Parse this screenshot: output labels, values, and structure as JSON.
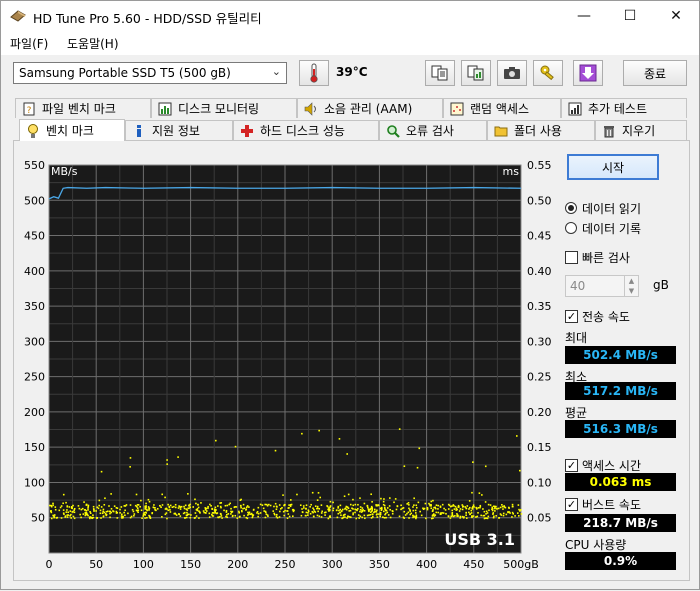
{
  "window": {
    "title": "HD Tune Pro 5.60 - HDD/SSD  유틸리티",
    "minimize": "—",
    "maximize": "☐",
    "close": "✕"
  },
  "menu": {
    "file_label": "파일(F)",
    "help_label": "도움말(H)"
  },
  "toolbar": {
    "drive": "Samsung Portable SSD T5 (500 gB)",
    "temperature": "39°C",
    "exit_label": "종료",
    "icons": [
      "thermometer-icon",
      "copy-text-icon",
      "copy-image-icon",
      "camera-icon",
      "keys-icon",
      "download-icon"
    ]
  },
  "tabs_top": [
    {
      "label": "파일 벤치 마크",
      "icon": "file-benchmark-icon"
    },
    {
      "label": "디스크 모니터링",
      "icon": "disk-monitor-icon"
    },
    {
      "label": "소음 관리 (AAM)",
      "icon": "speaker-icon"
    },
    {
      "label": "랜덤 액세스",
      "icon": "random-access-icon"
    },
    {
      "label": "추가 테스트",
      "icon": "extra-tests-icon"
    }
  ],
  "tabs_bottom": [
    {
      "label": "벤치 마크",
      "icon": "benchmark-icon"
    },
    {
      "label": "지원 정보",
      "icon": "info-icon"
    },
    {
      "label": "하드 디스크 성능",
      "icon": "health-icon"
    },
    {
      "label": "오류 검사",
      "icon": "error-scan-icon"
    },
    {
      "label": "폴더 사용",
      "icon": "folder-icon"
    },
    {
      "label": "지우기",
      "icon": "erase-icon"
    }
  ],
  "controls": {
    "start_label": "시작",
    "read_label": "데이터 읽기",
    "write_label": "데이터 기록",
    "read_selected": true,
    "quick_label": "빠른 검사",
    "quick_checked": false,
    "quick_value": "40",
    "quick_unit": "gB",
    "transfer_label": "전송 속도",
    "transfer_checked": true,
    "max_label": "최대",
    "max_value": "502.4 MB/s",
    "min_label": "최소",
    "min_value": "517.2 MB/s",
    "avg_label": "평균",
    "avg_value": "516.3 MB/s",
    "access_label": "액세스 시간",
    "access_checked": true,
    "access_value": "0.063 ms",
    "burst_label": "버스트 속도",
    "burst_checked": true,
    "burst_value": "218.7 MB/s",
    "cpu_label": "CPU 사용량",
    "cpu_value": "0.9%"
  },
  "chart_data": {
    "type": "line",
    "left_unit": "MB/s",
    "right_unit": "ms",
    "x_unit": "gB",
    "watermark": "USB 3.1",
    "y_left_ticks": [
      50,
      100,
      150,
      200,
      250,
      300,
      350,
      400,
      450,
      500,
      550
    ],
    "y_right_ticks": [
      "0.05",
      "0.10",
      "0.15",
      "0.20",
      "0.25",
      "0.30",
      "0.35",
      "0.40",
      "0.45",
      "0.50",
      "0.55"
    ],
    "x_ticks": [
      0,
      50,
      100,
      150,
      200,
      250,
      300,
      350,
      400,
      450,
      "500gB"
    ],
    "xlim": [
      0,
      500
    ],
    "ylim_left": [
      0,
      550
    ],
    "ylim_right": [
      0,
      0.55
    ],
    "series": [
      {
        "name": "",
        "axis": "left",
        "color": "#4aa8e8",
        "x": [
          0,
          5,
          10,
          15,
          20,
          40,
          60,
          100,
          150,
          200,
          250,
          300,
          350,
          400,
          450,
          500
        ],
        "y": [
          502,
          505,
          503,
          517,
          518,
          517,
          518,
          517,
          518,
          517,
          517,
          518,
          517,
          517,
          518,
          517
        ]
      }
    ],
    "access_time_scatter": {
      "color": "#ffff00",
      "typical_ms_range": [
        0.05,
        0.07
      ],
      "outliers_ms": [
        0.12,
        0.125,
        0.13,
        0.14,
        0.15,
        0.165,
        0.175
      ]
    },
    "colors": {
      "background": "#1a1a1a",
      "grid": "#6e6e6e"
    }
  }
}
